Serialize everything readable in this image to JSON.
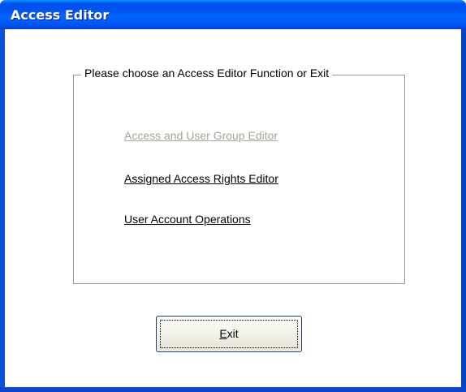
{
  "window": {
    "title": "Access Editor"
  },
  "group": {
    "legend": "Please choose an Access Editor Function or Exit",
    "options": [
      {
        "label": "Access and User Group Editor",
        "enabled": false
      },
      {
        "label": "Assigned Access Rights Editor",
        "enabled": true
      },
      {
        "label": "User Account Operations",
        "enabled": true
      }
    ]
  },
  "exit_button": {
    "mnemonic": "E",
    "rest": "xit"
  },
  "colors": {
    "titlebar": "#0053ee",
    "disabled_text": "#a6a49a"
  }
}
